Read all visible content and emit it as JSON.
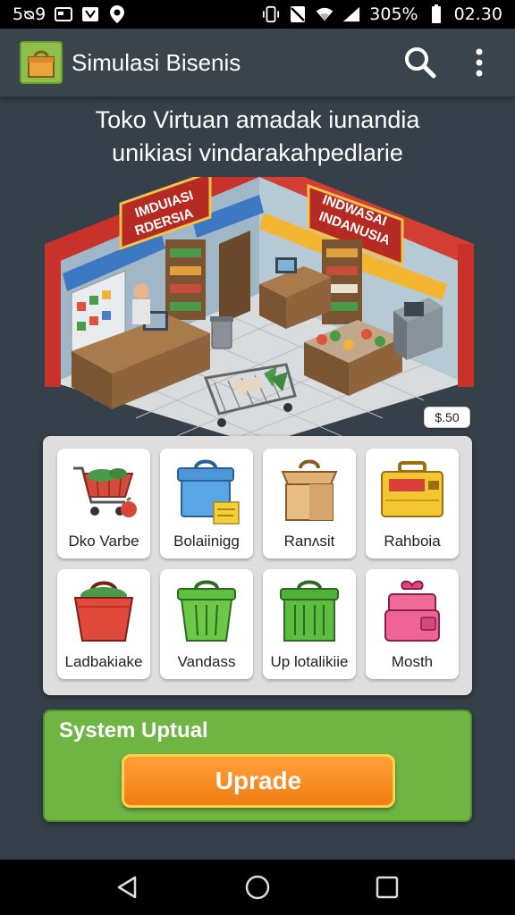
{
  "statusbar": {
    "left_text": "5ᴓ9",
    "battery": "305%",
    "time": "02.30"
  },
  "appbar": {
    "title": "Simulasi Bisenis",
    "icons": [
      "store-logo-icon",
      "search-icon",
      "more-vert-icon"
    ]
  },
  "headline": {
    "line1": "Toko Virtuan amadak iunandia",
    "line2": "unikiasi vindarakahpedlarie"
  },
  "scene": {
    "sign_left_line1": "IMDUIASI",
    "sign_left_line2": "RDERSIA",
    "sign_right_line1": "INDWASAI",
    "sign_right_line2": "INDANUSIA",
    "price": "$.50"
  },
  "categories": [
    {
      "label": "Dko Varbe",
      "icon": "shopping-cart-icon"
    },
    {
      "label": "Bolaiinigg",
      "icon": "blue-container-icon"
    },
    {
      "label": "Ranʌsit",
      "icon": "cardboard-box-icon"
    },
    {
      "label": "Rahboia",
      "icon": "yellow-toolbox-icon"
    },
    {
      "label": "Ladbakiake",
      "icon": "red-produce-basket-icon"
    },
    {
      "label": "Vandass",
      "icon": "green-bin-icon"
    },
    {
      "label": "Up lotalikiie",
      "icon": "green-crate-icon"
    },
    {
      "label": "Mosth",
      "icon": "pink-bag-icon"
    }
  ],
  "system": {
    "title": "System Uptual",
    "button_label": "Uprade"
  },
  "colors": {
    "appbar": "#3a444d",
    "background": "#35404a",
    "system_panel": "#6fb544",
    "upgrade_button": "#f07e12"
  }
}
